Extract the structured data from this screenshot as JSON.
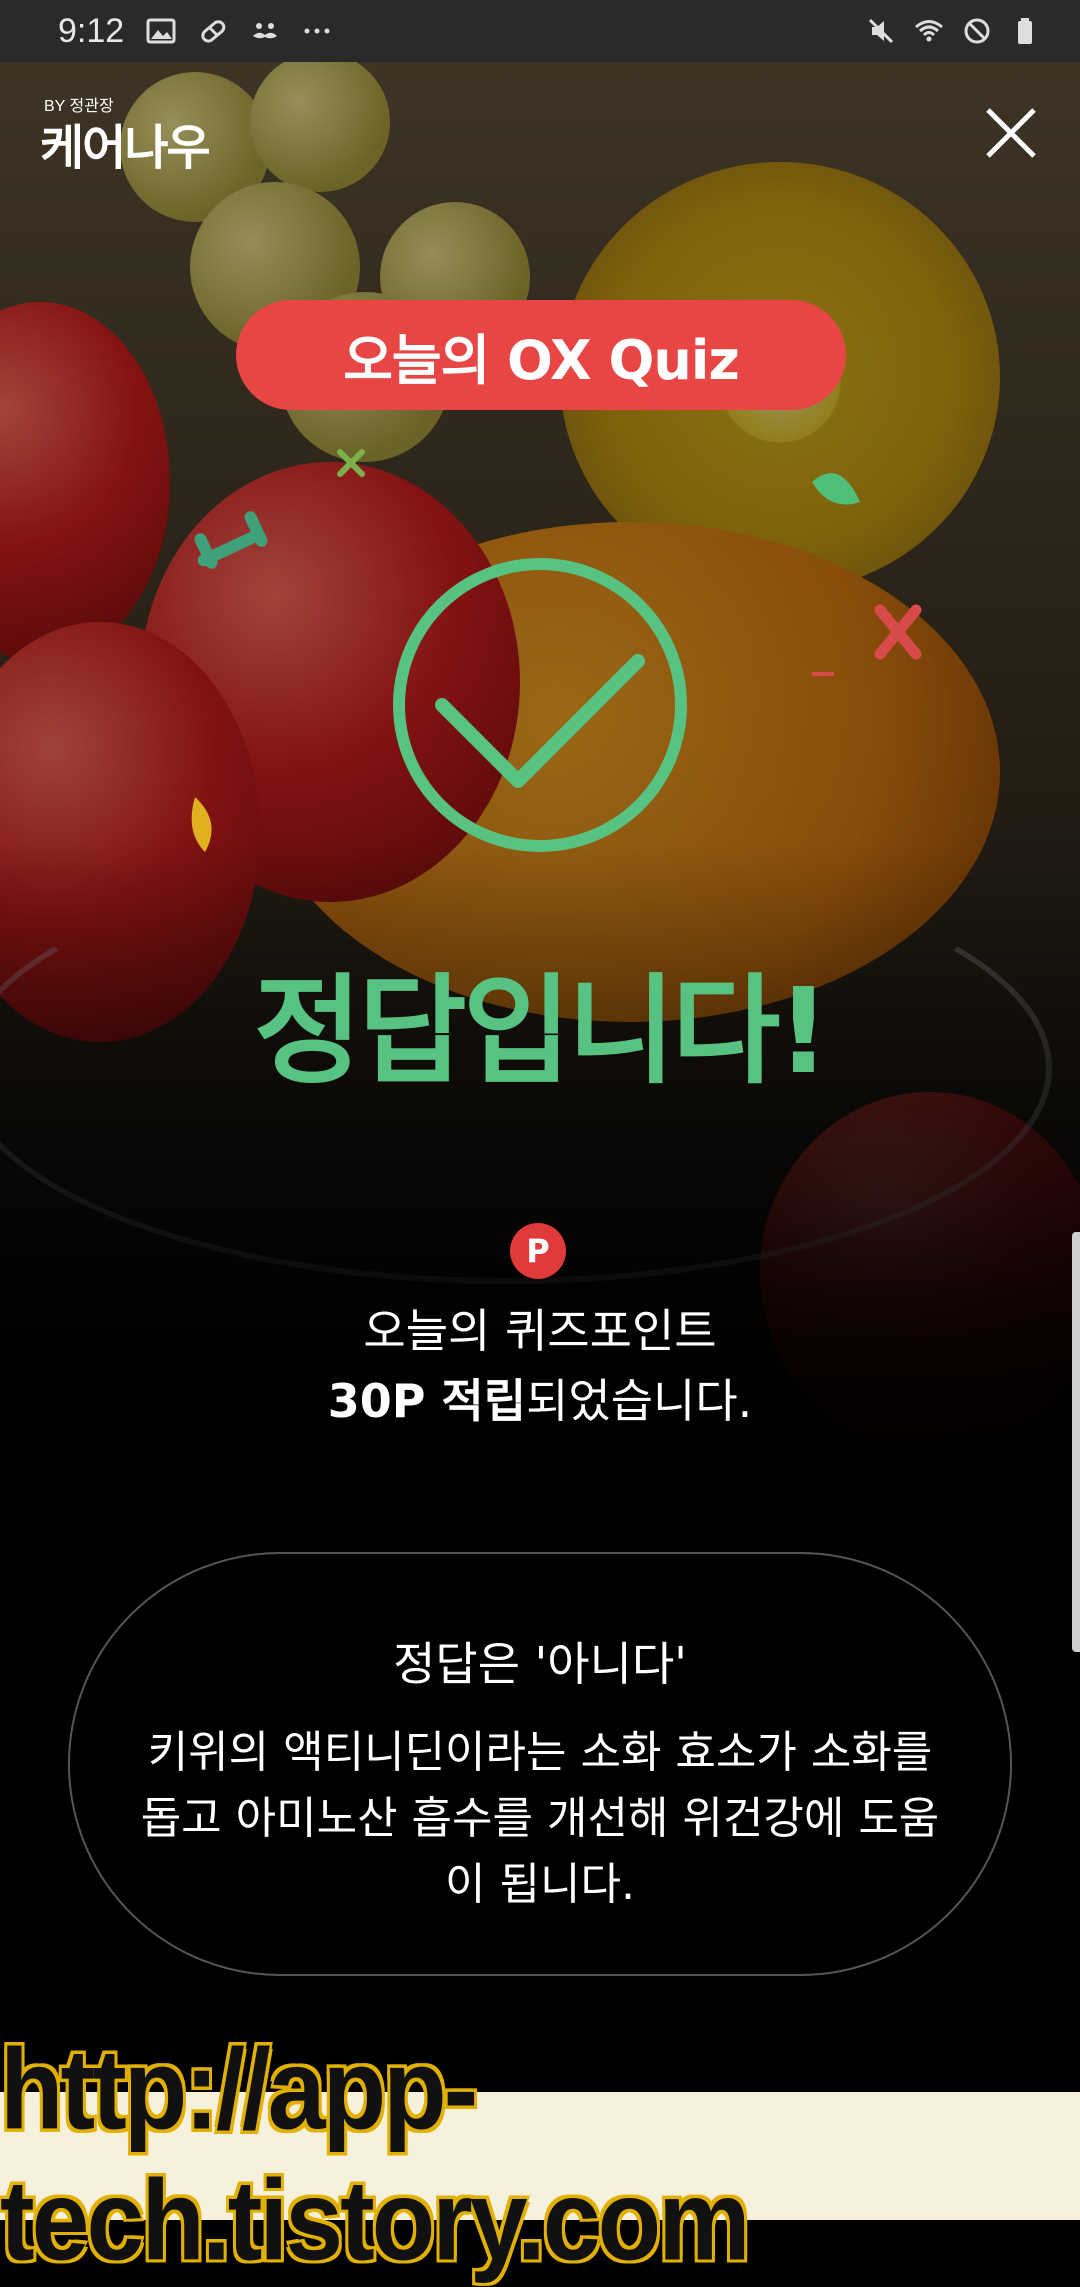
{
  "status_bar": {
    "time": "9:12",
    "left_icons": [
      "image-icon",
      "pill-icon",
      "mustache-icon",
      "more-dots-icon"
    ],
    "right_icons": [
      "mute-icon",
      "wifi-icon",
      "no-sync-icon",
      "battery-icon"
    ]
  },
  "header": {
    "logo_small": "BY 정관장",
    "logo": "케어나우"
  },
  "quiz": {
    "pill_label": "오늘의 OX Quiz",
    "result": "정답입니다!",
    "point_badge": "P",
    "point_line1": "오늘의 퀴즈포인트",
    "point_amount": "30P 적립",
    "point_line2_rest": "되었습니다."
  },
  "answer": {
    "title": "정답은 '아니다'",
    "body": "키위의 액티니딘이라는 소화 효소가 소화를 돕고 아미노산 흡수를 개선해 위건강에 도움이 됩니다."
  },
  "watermark": "http://app-tech.tistory.com",
  "colors": {
    "accent_red": "#e84545",
    "success_green": "#57c281",
    "point_red": "#e03a3a"
  }
}
